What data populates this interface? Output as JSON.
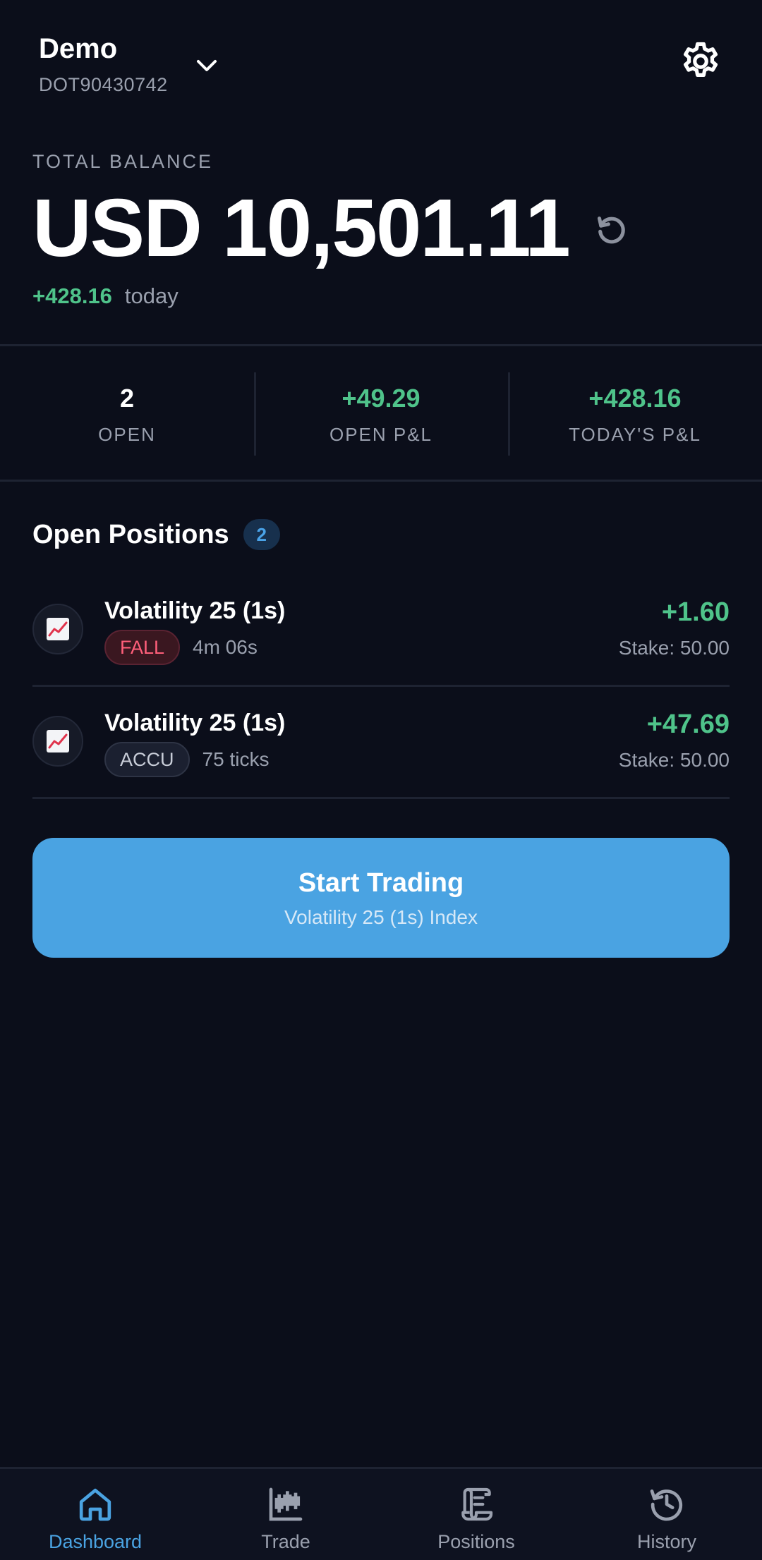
{
  "account": {
    "name": "Demo",
    "id": "DOT90430742"
  },
  "balance": {
    "label": "TOTAL BALANCE",
    "value": "USD 10,501.11",
    "change": "+428.16",
    "change_label": "today"
  },
  "stats": [
    {
      "value": "2",
      "label": "OPEN"
    },
    {
      "value": "+49.29",
      "label": "OPEN P&L"
    },
    {
      "value": "+428.16",
      "label": "TODAY'S P&L"
    }
  ],
  "positions": {
    "title": "Open Positions",
    "count": "2",
    "items": [
      {
        "name": "Volatility 25 (1s)",
        "tag": "FALL",
        "detail": "4m 06s",
        "pl": "+1.60",
        "stake": "Stake: 50.00",
        "icon": "chart-up-icon"
      },
      {
        "name": "Volatility 25 (1s)",
        "tag": "ACCU",
        "detail": "75 ticks",
        "pl": "+47.69",
        "stake": "Stake: 50.00",
        "icon": "chart-up-icon"
      }
    ]
  },
  "cta": {
    "title": "Start Trading",
    "subtitle": "Volatility 25 (1s) Index"
  },
  "nav": [
    {
      "label": "Dashboard",
      "icon": "home-icon",
      "active": true
    },
    {
      "label": "Trade",
      "icon": "candlestick-icon",
      "active": false
    },
    {
      "label": "Positions",
      "icon": "scroll-icon",
      "active": false
    },
    {
      "label": "History",
      "icon": "history-icon",
      "active": false
    }
  ],
  "colors": {
    "background": "#0b0e1a",
    "accent": "#4aa3e2",
    "positive": "#4fc38a",
    "negative": "#ff5f7a"
  }
}
